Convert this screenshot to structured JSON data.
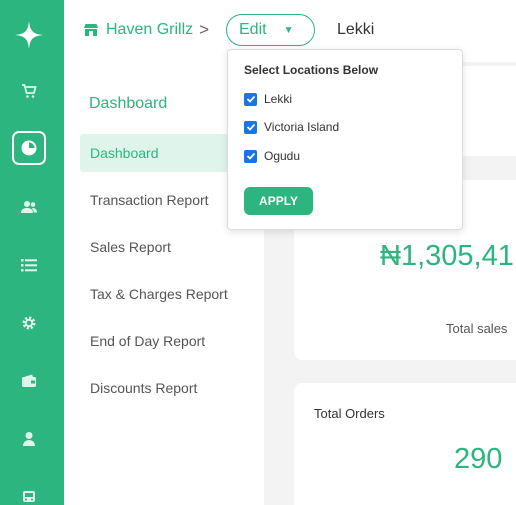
{
  "rail": {
    "icons": [
      "sparkle-logo-icon",
      "cart-icon",
      "dashboard-pie-icon",
      "users-icon",
      "list-icon",
      "gear-icon",
      "wallet-icon",
      "user-icon",
      "bus-icon"
    ],
    "accent": "#2cb57e"
  },
  "header": {
    "store_name": "Haven Grillz",
    "chevron": ">",
    "edit_label": "Edit",
    "selected_location": "Lekki"
  },
  "dropdown": {
    "title": "Select Locations Below",
    "options": [
      {
        "label": "Lekki",
        "checked": true
      },
      {
        "label": "Victoria Island",
        "checked": true
      },
      {
        "label": "Ogudu",
        "checked": true
      }
    ],
    "apply_label": "APPLY"
  },
  "sidebar": {
    "section_title": "Dashboard",
    "items": [
      {
        "label": "Dashboard",
        "active": true
      },
      {
        "label": "Transaction Report"
      },
      {
        "label": "Sales Report"
      },
      {
        "label": "Tax & Charges Report"
      },
      {
        "label": "End of Day Report"
      },
      {
        "label": "Discounts Report"
      }
    ]
  },
  "cards": {
    "total_sales_value": "₦1,305,41",
    "total_sales_label": "Total sales",
    "total_orders_label": "Total Orders",
    "total_orders_value": "290"
  }
}
